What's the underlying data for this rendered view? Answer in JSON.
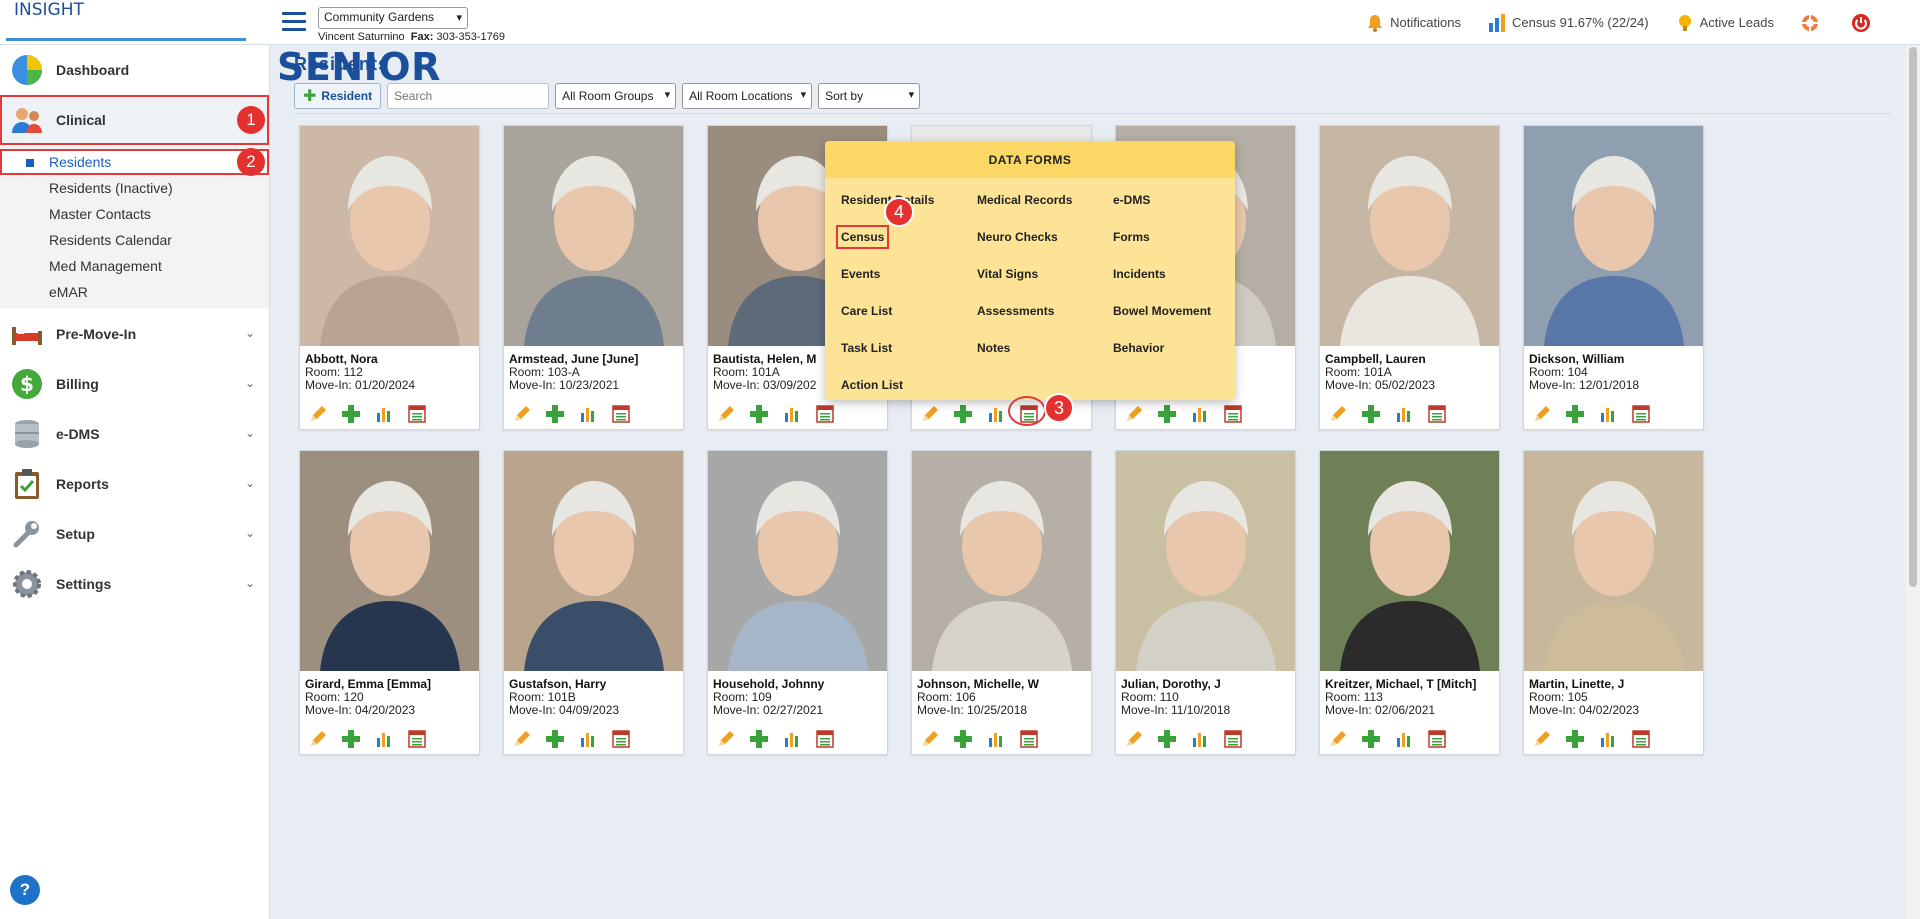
{
  "app": {
    "logo_main": "SENIOR",
    "logo_sub": "INSIGHT",
    "facility": "Community Gardens",
    "contact_name": "Vincent Saturnino",
    "fax_label": "Fax:",
    "fax_value": "303-353-1769"
  },
  "header": {
    "notifications": "Notifications",
    "census": "Census 91.67% (22/24)",
    "active_leads": "Active Leads"
  },
  "sidebar": {
    "dashboard": "Dashboard",
    "clinical": "Clinical",
    "clinical_badge": "1",
    "clinical_items": [
      {
        "label": "Residents"
      },
      {
        "label": "Residents (Inactive)"
      },
      {
        "label": "Master Contacts"
      },
      {
        "label": "Residents Calendar"
      },
      {
        "label": "Med Management"
      },
      {
        "label": "eMAR"
      }
    ],
    "residents_badge": "2",
    "sections": [
      {
        "label": "Pre-Move-In"
      },
      {
        "label": "Billing"
      },
      {
        "label": "e-DMS"
      },
      {
        "label": "Reports"
      },
      {
        "label": "Setup"
      },
      {
        "label": "Settings"
      }
    ],
    "help": "?"
  },
  "main": {
    "title": "Residents",
    "add_button": "Resident",
    "search_placeholder": "Search",
    "room_groups": "All Room Groups",
    "room_locations": "All Room Locations",
    "sort_by": "Sort by"
  },
  "residents": [
    {
      "name": "Abbott, Nora",
      "room": "Room: 112",
      "move_in": "Move-In: 01/20/2024"
    },
    {
      "name": "Armstead, June [June]",
      "room": "Room: 103-A",
      "move_in": "Move-In: 10/23/2021"
    },
    {
      "name": "Bautista, Helen, M",
      "room": "Room: 101A",
      "move_in": "Move-In: 03/09/202"
    },
    {
      "name": "",
      "room": "",
      "move_in": ""
    },
    {
      "name": "",
      "room": "",
      "move_in": "3"
    },
    {
      "name": "Campbell, Lauren",
      "room": "Room: 101A",
      "move_in": "Move-In: 05/02/2023"
    },
    {
      "name": "Dickson, William",
      "room": "Room: 104",
      "move_in": "Move-In: 12/01/2018"
    },
    {
      "name": "Girard, Emma [Emma]",
      "room": "Room: 120",
      "move_in": "Move-In: 04/20/2023"
    },
    {
      "name": "Gustafson, Harry",
      "room": "Room: 101B",
      "move_in": "Move-In: 04/09/2023"
    },
    {
      "name": "Household, Johnny",
      "room": "Room: 109",
      "move_in": "Move-In: 02/27/2021"
    },
    {
      "name": "Johnson, Michelle, W",
      "room": "Room: 106",
      "move_in": "Move-In: 10/25/2018"
    },
    {
      "name": "Julian, Dorothy, J",
      "room": "Room: 110",
      "move_in": "Move-In: 11/10/2018"
    },
    {
      "name": "Kreitzer, Michael, T [Mitch]",
      "room": "Room: 113",
      "move_in": "Move-In: 02/06/2021"
    },
    {
      "name": "Martin, Linette, J",
      "room": "Room: 105",
      "move_in": "Move-In: 04/02/2023"
    }
  ],
  "popup": {
    "title": "DATA FORMS",
    "col1": [
      "Resident Details",
      "Census",
      "Events",
      "Care List",
      "Task List",
      "Action List"
    ],
    "col2": [
      "Medical Records",
      "Neuro Checks",
      "Vital Signs",
      "Assessments",
      "Notes"
    ],
    "col3": [
      "e-DMS",
      "Forms",
      "Incidents",
      "Bowel Movement",
      "Behavior"
    ],
    "badge_census": "4",
    "badge_icon": "3"
  },
  "colors": {
    "brand": "#1b4e9b",
    "highlight": "#e03a3a",
    "popup_bg": "#fde396"
  }
}
